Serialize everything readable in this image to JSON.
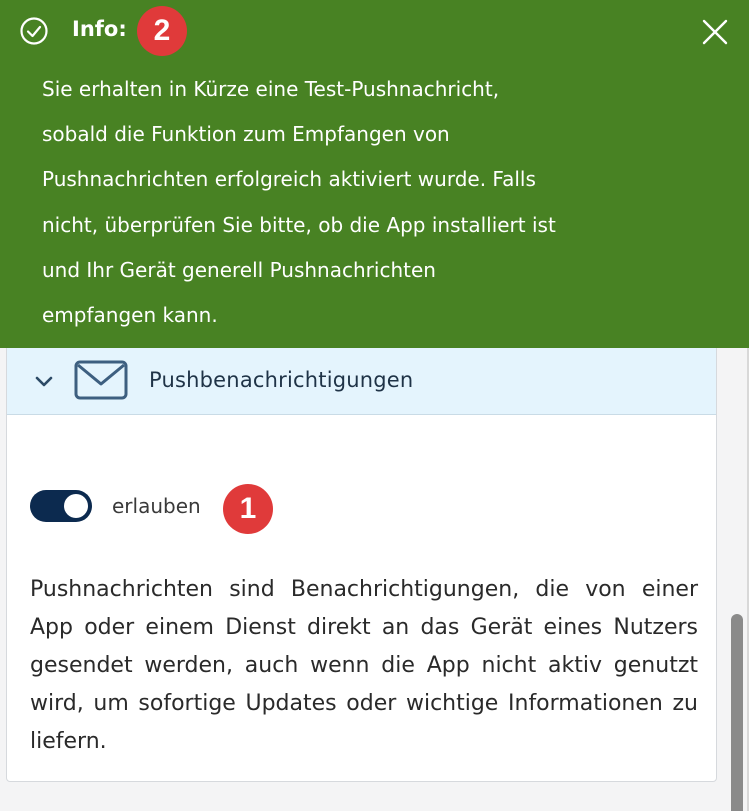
{
  "info_banner": {
    "title": "Info:",
    "lines": [
      "Sie erhalten in Kürze eine Test-Pushnachricht,",
      "sobald die Funktion zum Empfangen von",
      "Pushnachrichten erfolgreich aktiviert wurde. Falls",
      "nicht, überprüfen Sie bitte, ob die App installiert ist",
      "und Ihr Gerät generell Pushnachrichten",
      "empfangen kann."
    ],
    "icon": "check-circle-icon",
    "close_icon": "close-icon",
    "background_color": "#488223"
  },
  "badges": {
    "step_1": "1",
    "step_2": "2",
    "color": "#e03a3a"
  },
  "section": {
    "title": "Pushbenachrichtigungen",
    "expand_icon": "chevron-down-icon",
    "icon": "envelope-icon",
    "header_color": "#e4f4fd"
  },
  "toggle": {
    "label": "erlauben",
    "state": "on",
    "color": "#0c2a4f"
  },
  "description": "Pushnachrichten sind Benachrichtigungen, die von ei­ner App oder einem Dienst direkt an das Gerät eines Nutzers gesendet werden, auch wenn die App nicht aktiv genutzt wird, um sofortige Updates oder wich­tige Informationen zu liefern."
}
